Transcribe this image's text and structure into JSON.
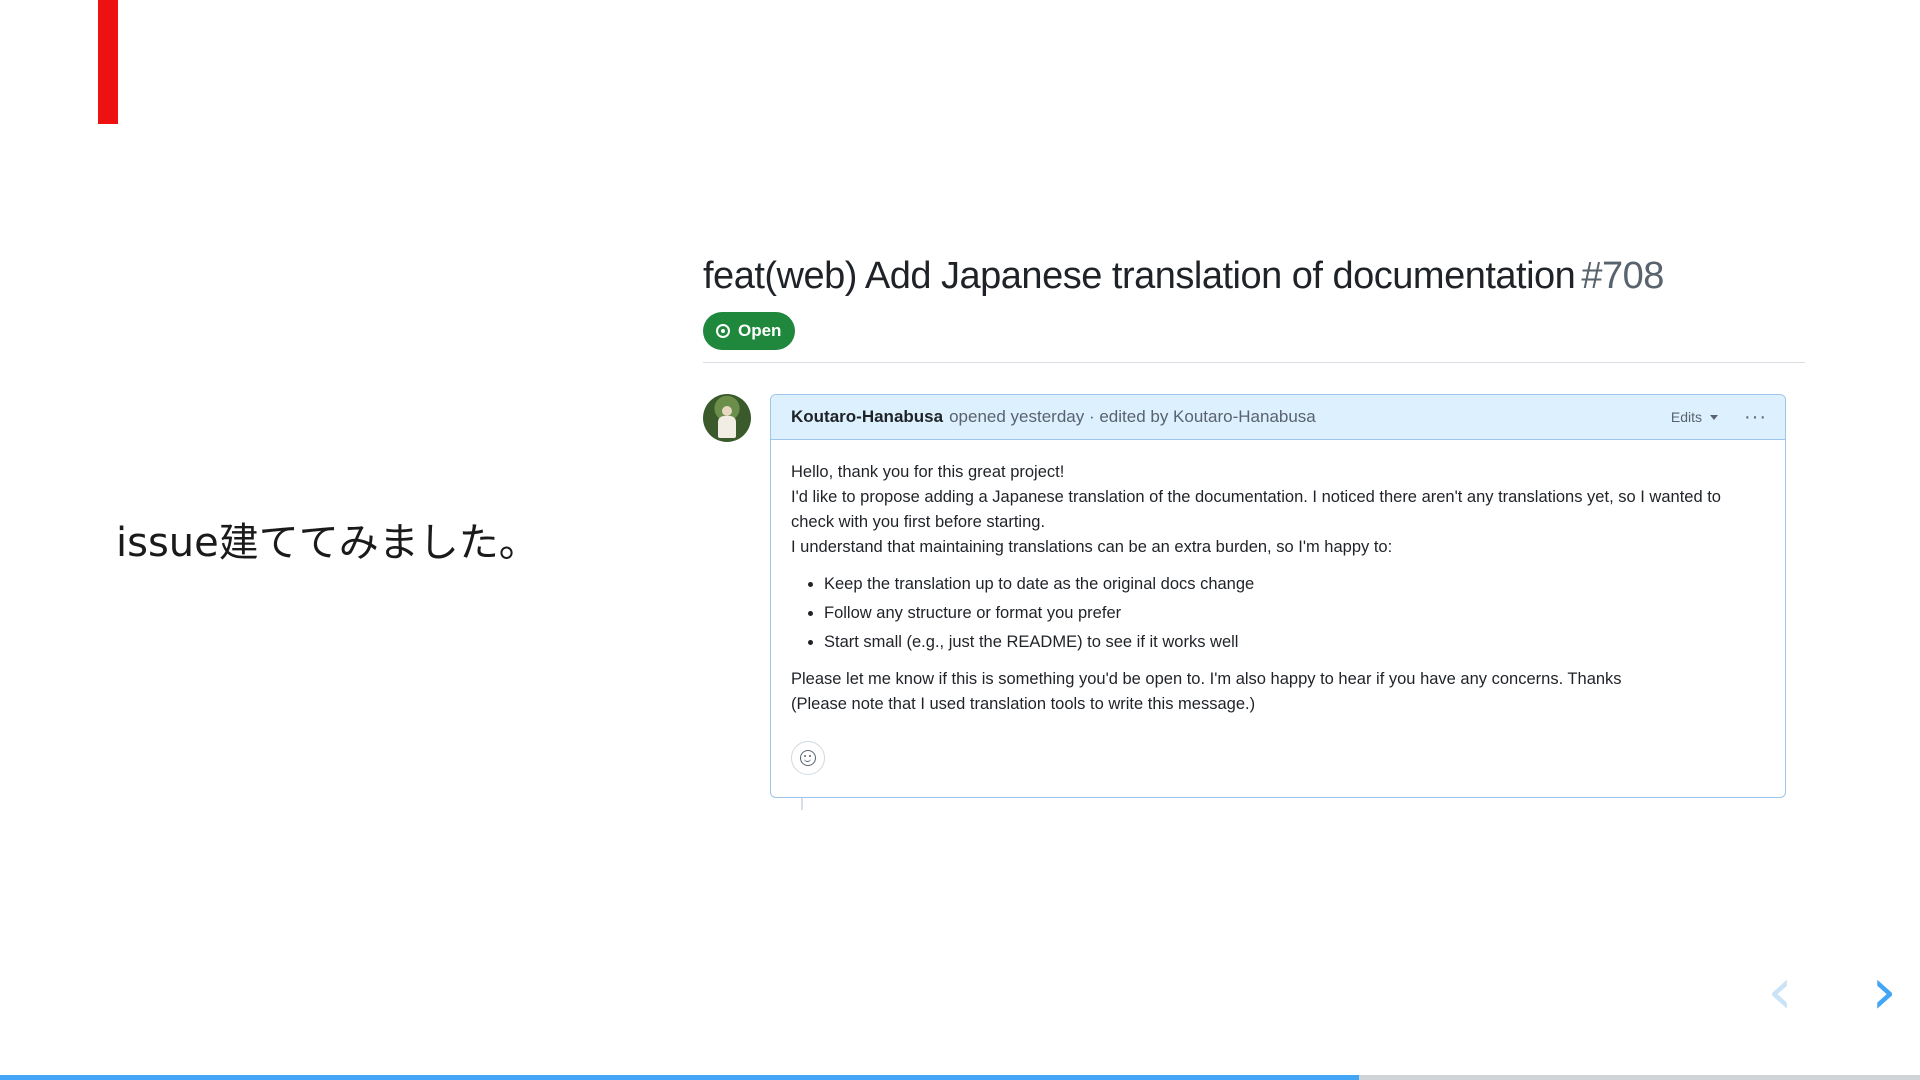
{
  "slide": {
    "text": "issue建ててみました。",
    "progress": 0.708
  },
  "issue": {
    "title": "feat(web) Add Japanese translation of documentation",
    "number": "#708",
    "state": "Open"
  },
  "comment": {
    "author": "Koutaro-Hanabusa",
    "meta": "opened yesterday · edited by Koutaro-Hanabusa",
    "edits_label": "Edits",
    "more_label": "···",
    "body": {
      "p1": "Hello, thank you for this great project!",
      "p2": "I'd like to propose adding a Japanese translation of the documentation. I noticed there aren't any translations yet, so I wanted to check with you first before starting.",
      "p3": "I understand that maintaining translations can be an extra burden, so I'm happy to:",
      "bullets": [
        "Keep the translation up to date as the original docs change",
        "Follow any structure or format you prefer",
        "Start small (e.g., just the README) to see if it works well"
      ],
      "p4": "Please let me know if this is something you'd be open to. I'm also happy to hear if you have any concerns. Thanks",
      "p5": "(Please note that I used translation tools to write this message.)"
    }
  },
  "nav": {
    "prev": "‹",
    "next": "›"
  },
  "colors": {
    "accent_red": "#ee1111",
    "open_green": "#1f883d",
    "progress_blue": "#42a5f5"
  }
}
